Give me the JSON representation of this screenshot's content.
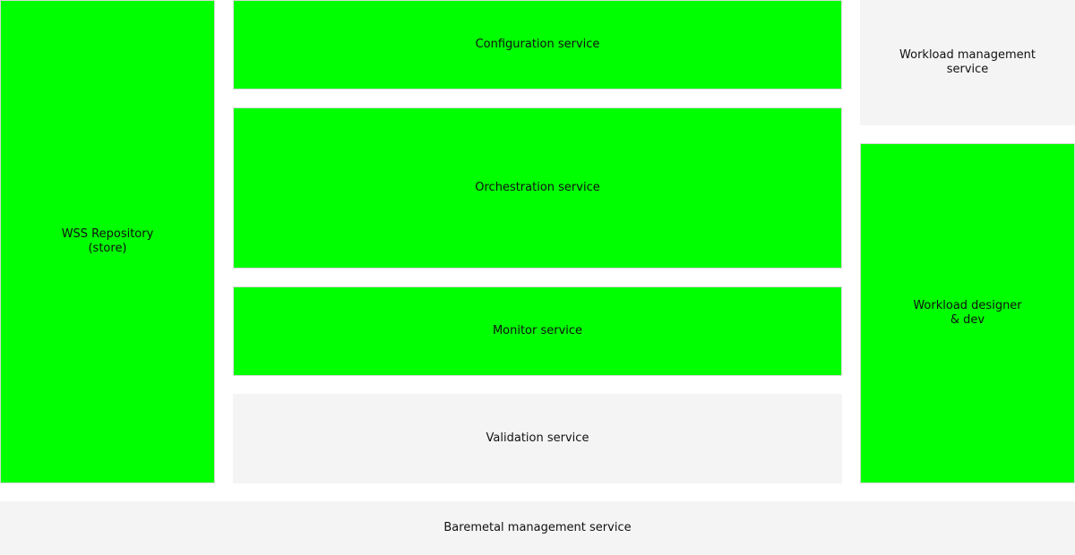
{
  "colors": {
    "active": "#00ff00",
    "inactive": "#f4f4f4",
    "text": "#111111"
  },
  "boxes": {
    "wss_repository": {
      "line1": "WSS Repository",
      "line2": "(store)",
      "status": "active"
    },
    "configuration": {
      "label": "Configuration service",
      "status": "active"
    },
    "orchestration": {
      "label": "Orchestration service",
      "status": "active"
    },
    "monitor": {
      "label": "Monitor service",
      "status": "active"
    },
    "validation": {
      "label": "Validation service",
      "status": "inactive"
    },
    "workload_management": {
      "line1": "Workload management",
      "line2": "service",
      "status": "inactive"
    },
    "workload_designer": {
      "line1": "Workload designer",
      "line2": "& dev",
      "status": "active"
    },
    "baremetal": {
      "label": "Baremetal management service",
      "status": "inactive"
    }
  }
}
